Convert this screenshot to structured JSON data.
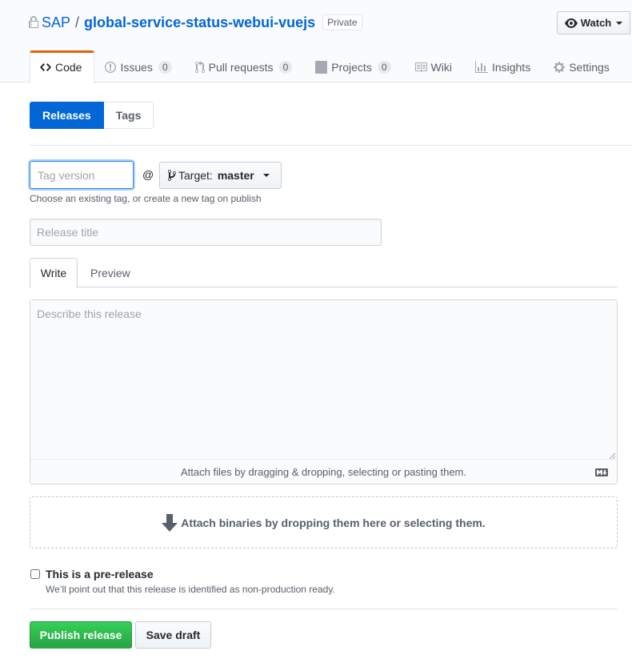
{
  "repo": {
    "owner": "SAP",
    "separator": "/",
    "name": "global-service-status-webui-vuejs",
    "visibility_label": "Private",
    "watch_label": "Watch"
  },
  "reponav": [
    {
      "label": "Code",
      "icon": "code-icon",
      "selected": true
    },
    {
      "label": "Issues",
      "icon": "issue-icon",
      "count": "0"
    },
    {
      "label": "Pull requests",
      "icon": "pull-request-icon",
      "count": "0"
    },
    {
      "label": "Projects",
      "icon": "project-icon",
      "count": "0"
    },
    {
      "label": "Wiki",
      "icon": "book-icon"
    },
    {
      "label": "Insights",
      "icon": "graph-icon"
    },
    {
      "label": "Settings",
      "icon": "gear-icon"
    }
  ],
  "subnav": {
    "releases_label": "Releases",
    "tags_label": "Tags"
  },
  "form": {
    "tag_placeholder": "Tag version",
    "at_sign": "@",
    "target_label": "Target:",
    "target_value": "master",
    "tag_hint": "Choose an existing tag, or create a new tag on publish",
    "title_placeholder": "Release title",
    "write_tab": "Write",
    "preview_tab": "Preview",
    "body_placeholder": "Describe this release",
    "attach_files_text": "Attach files by dragging & dropping, selecting or pasting them.",
    "attach_binaries_text": "Attach binaries by dropping them here or selecting them.",
    "prerelease_label": "This is a pre-release",
    "prerelease_note": "We’ll point out that this release is identified as non-production ready.",
    "publish_label": "Publish release",
    "draft_label": "Save draft"
  },
  "colors": {
    "link": "#0366d6",
    "primary": "#28a745",
    "selected_tab_accent": "#e36209"
  }
}
